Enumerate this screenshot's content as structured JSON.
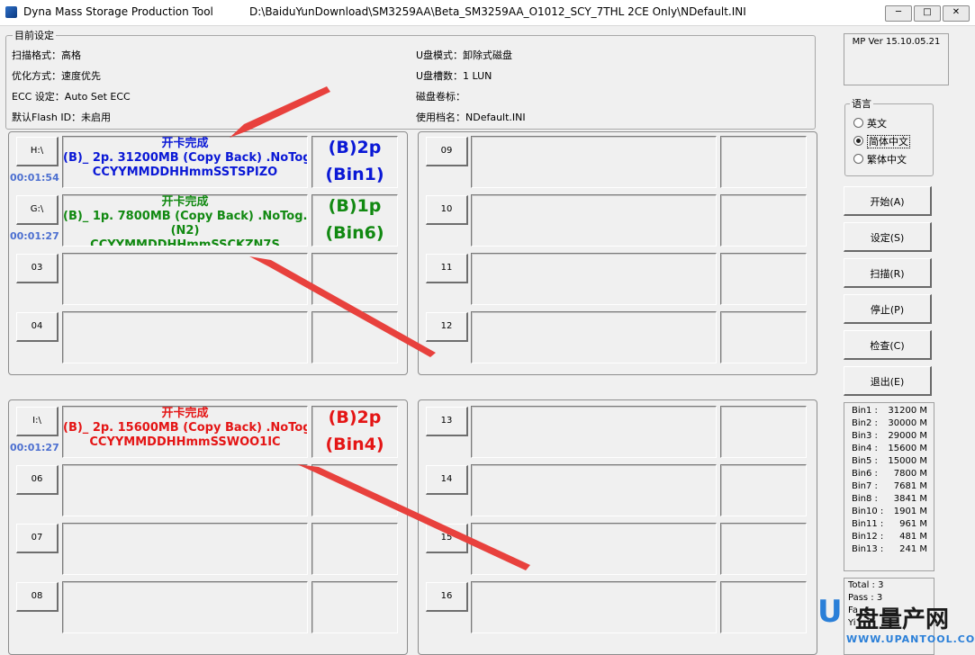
{
  "window": {
    "app_title": "Dyna Mass Storage Production Tool",
    "ini_path": "D:\\BaiduYunDownload\\SM3259AA\\Beta_SM3259AA_O1012_SCY_7THL 2CE Only\\NDefault.INI",
    "minimize": "─",
    "maximize": "□",
    "close": "✕"
  },
  "settings": {
    "group_title": "目前设定",
    "scan_format": "扫描格式：高格",
    "optimize": "优化方式：速度优先",
    "ecc": "ECC 设定：Auto Set ECC",
    "flash_id": "默认Flash ID：未启用",
    "disk_mode": "U盘模式：卸除式磁盘",
    "disk_slots": "U盘槽数：1 LUN",
    "volume_label": "磁盘卷标：",
    "ini_name": "使用档名：NDefault.INI"
  },
  "version": "MP Ver 15.10.05.21",
  "language": {
    "title": "语言",
    "options": [
      "英文",
      "简体中文",
      "繁体中文"
    ],
    "selected_index": 1
  },
  "buttons": {
    "start": "开始(A)",
    "setup": "设定(S)",
    "scan": "扫描(R)",
    "stop": "停止(P)",
    "check": "检查(C)",
    "exit": "退出(E)"
  },
  "bins": [
    {
      "name": "Bin1 :",
      "value": "31200 M"
    },
    {
      "name": "Bin2 :",
      "value": "30000 M"
    },
    {
      "name": "Bin3 :",
      "value": "29000 M"
    },
    {
      "name": "Bin4 :",
      "value": "15600 M"
    },
    {
      "name": "Bin5 :",
      "value": "15000 M"
    },
    {
      "name": "Bin6 :",
      "value": "7800 M"
    },
    {
      "name": "Bin7 :",
      "value": "7681 M"
    },
    {
      "name": "Bin8 :",
      "value": "3841 M"
    },
    {
      "name": "Bin10 :",
      "value": "1901 M"
    },
    {
      "name": "Bin11 :",
      "value": "961 M"
    },
    {
      "name": "Bin12 :",
      "value": "481 M"
    },
    {
      "name": "Bin13 :",
      "value": "241 M"
    }
  ],
  "totals": {
    "total": "Total : 3",
    "pass": "Pass : 3",
    "fail": "Fa",
    "yield": "Yi"
  },
  "ports": {
    "p01": {
      "label": "H:\\",
      "timer": "00:01:54",
      "status": "开卡完成",
      "line1": "(B)_ 2p. 31200MB  (Copy Back) .NoTog",
      "line2": "CCYYMMDDHHmmSSTSPIZO",
      "bin_a": "(B)2p",
      "bin_b": "(Bin1)"
    },
    "p02": {
      "label": "G:\\",
      "timer": "00:01:27",
      "status": "开卡完成",
      "line1": "(B)_ 1p.  7800MB  (Copy Back) .NoTog.",
      "line2": "(N2)",
      "line3": "CCYYMMDDHHmmSSCKZN7S",
      "bin_a": "(B)1p",
      "bin_b": "(Bin6)"
    },
    "p03": {
      "label": "03"
    },
    "p04": {
      "label": "04"
    },
    "p05": {
      "label": "I:\\",
      "timer": "00:01:27",
      "status": "开卡完成",
      "line1": "(B)_ 2p. 15600MB  (Copy Back) .NoTog",
      "line2": "CCYYMMDDHHmmSSWOO1IC",
      "bin_a": "(B)2p",
      "bin_b": "(Bin4)"
    },
    "p06": {
      "label": "06"
    },
    "p07": {
      "label": "07"
    },
    "p08": {
      "label": "08"
    },
    "p09": {
      "label": "09"
    },
    "p10": {
      "label": "10"
    },
    "p11": {
      "label": "11"
    },
    "p12": {
      "label": "12"
    },
    "p13": {
      "label": "13"
    },
    "p14": {
      "label": "14"
    },
    "p15": {
      "label": "15"
    },
    "p16": {
      "label": "16"
    }
  },
  "watermark": {
    "logo": "U",
    "brand": "盘量产网",
    "url": "WWW.UPANTOOL.COM"
  },
  "colors": {
    "status_blue": "#0a18d6",
    "status_green": "#118911",
    "status_red": "#e41515",
    "timer": "#4c6fd0",
    "arrow": "#e8413d"
  }
}
